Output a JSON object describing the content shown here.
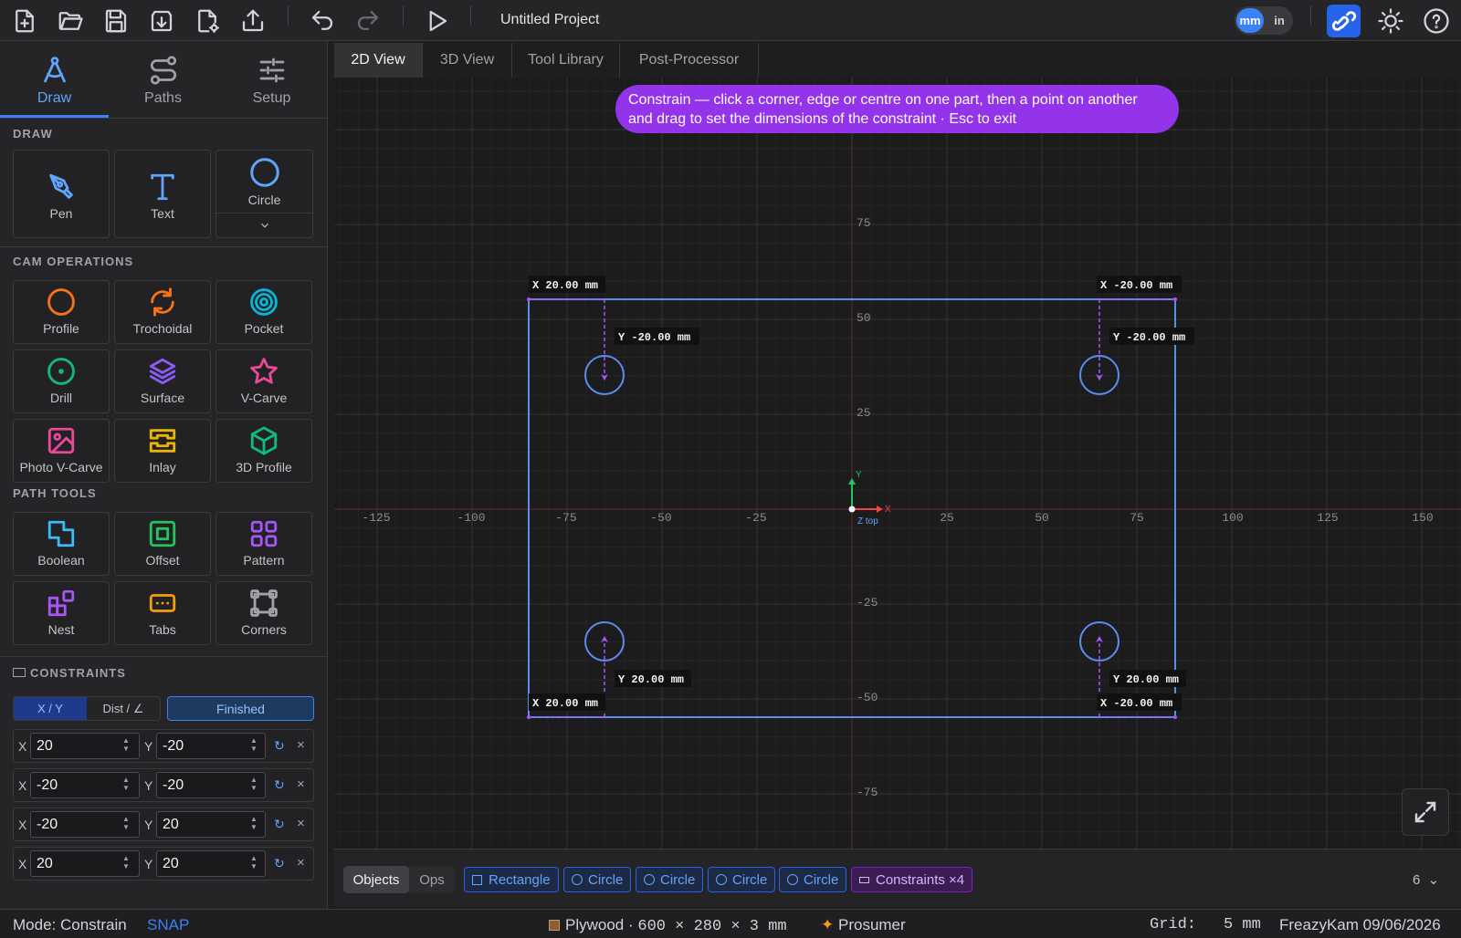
{
  "app": {
    "project_title": "Untitled Project"
  },
  "toolbar": {
    "icons": [
      "new-file-icon",
      "open-folder-icon",
      "save-icon",
      "download-icon",
      "file-settings-icon",
      "export-icon",
      "undo-icon",
      "redo-icon",
      "run-icon"
    ],
    "unit_mm": "mm",
    "unit_in": "in"
  },
  "sidebar": {
    "tabs": [
      {
        "label": "Draw",
        "icon": "compass-icon",
        "active": true
      },
      {
        "label": "Paths",
        "icon": "paths-icon"
      },
      {
        "label": "Setup",
        "icon": "sliders-icon"
      }
    ],
    "draw_title": "DRAW",
    "draw_tools": [
      {
        "label": "Pen",
        "icon": "pen-icon"
      },
      {
        "label": "Text",
        "icon": "text-icon"
      },
      {
        "label": "Circle",
        "icon": "circle-icon"
      }
    ],
    "cam_title": "CAM OPERATIONS",
    "cam_tools": [
      {
        "label": "Profile",
        "icon": "profile-icon",
        "color": "#f97316"
      },
      {
        "label": "Trochoidal",
        "icon": "trochoidal-icon",
        "color": "#f97316"
      },
      {
        "label": "Pocket",
        "icon": "pocket-icon",
        "color": "#06b6d4"
      },
      {
        "label": "Drill",
        "icon": "drill-icon",
        "color": "#10b981"
      },
      {
        "label": "Surface",
        "icon": "layers-icon",
        "color": "#8b5cf6"
      },
      {
        "label": "V-Carve",
        "icon": "star-icon",
        "color": "#ec4899"
      },
      {
        "label": "Photo V-Carve",
        "icon": "image-icon",
        "color": "#ec4899"
      },
      {
        "label": "Inlay",
        "icon": "inlay-icon",
        "color": "#eab308"
      },
      {
        "label": "3D Profile",
        "icon": "cube-icon",
        "color": "#10b981"
      }
    ],
    "path_title": "PATH TOOLS",
    "path_tools": [
      {
        "label": "Boolean",
        "icon": "boolean-icon",
        "color": "#38bdf8"
      },
      {
        "label": "Offset",
        "icon": "offset-icon",
        "color": "#22c55e"
      },
      {
        "label": "Pattern",
        "icon": "grid-icon",
        "color": "#a855f7"
      },
      {
        "label": "Nest",
        "icon": "nest-icon",
        "color": "#a855f7"
      },
      {
        "label": "Tabs",
        "icon": "tabs-icon",
        "color": "#f59e0b"
      },
      {
        "label": "Corners",
        "icon": "corners-icon",
        "color": "#a1a1aa"
      }
    ],
    "constraints": {
      "title": "CONSTRAINTS",
      "mode_xy": "X / Y",
      "mode_dist": "Dist / ∠",
      "finished_label": "Finished",
      "x_label": "X",
      "y_label": "Y",
      "rows": [
        {
          "x": "20",
          "y": "-20"
        },
        {
          "x": "-20",
          "y": "-20"
        },
        {
          "x": "-20",
          "y": "20"
        },
        {
          "x": "20",
          "y": "20"
        }
      ]
    }
  },
  "view_tabs": [
    {
      "label": "2D View",
      "active": true
    },
    {
      "label": "3D View"
    },
    {
      "label": "Tool Library"
    },
    {
      "label": "Post-Processor"
    }
  ],
  "canvas": {
    "hint_line1": "Constrain — click a corner, edge or centre on one part, then a point on another",
    "hint_line2": "and drag to set the dimensions of the constraint · Esc to exit",
    "x_ticks": [
      "-125",
      "-100",
      "-75",
      "-50",
      "-25",
      "25",
      "50",
      "75",
      "100",
      "125",
      "150"
    ],
    "y_ticks": [
      "75",
      "50",
      "25",
      "-25",
      "-50",
      "-75"
    ],
    "axis_y": "Y",
    "axis_x": "X",
    "axis_z": "Z top",
    "labels": {
      "tl_x": "X 20.00 mm",
      "tr_x": "X -20.00 mm",
      "tl_y": "Y -20.00 mm",
      "tr_y": "Y -20.00 mm",
      "bl_y": "Y 20.00 mm",
      "br_y": "Y 20.00 mm",
      "bl_x": "X 20.00 mm",
      "br_x": "X -20.00 mm"
    },
    "rect_color": "#5b8def",
    "constraint_color": "#a855f7"
  },
  "bottom": {
    "objects_label": "Objects",
    "ops_label": "Ops",
    "chips": [
      "Rectangle",
      "Circle",
      "Circle",
      "Circle",
      "Circle"
    ],
    "constraints_chip": "Constraints ×4",
    "count": "6"
  },
  "status": {
    "mode": "Mode: Constrain",
    "snap": "SNAP",
    "material": "Plywood · ",
    "material_dims": "600 × 280 × 3 mm",
    "machine": "Prosumer",
    "grid_label": "Grid:",
    "grid_value": "5 mm",
    "brand_date": "FreazyKam 09/06/2026"
  }
}
